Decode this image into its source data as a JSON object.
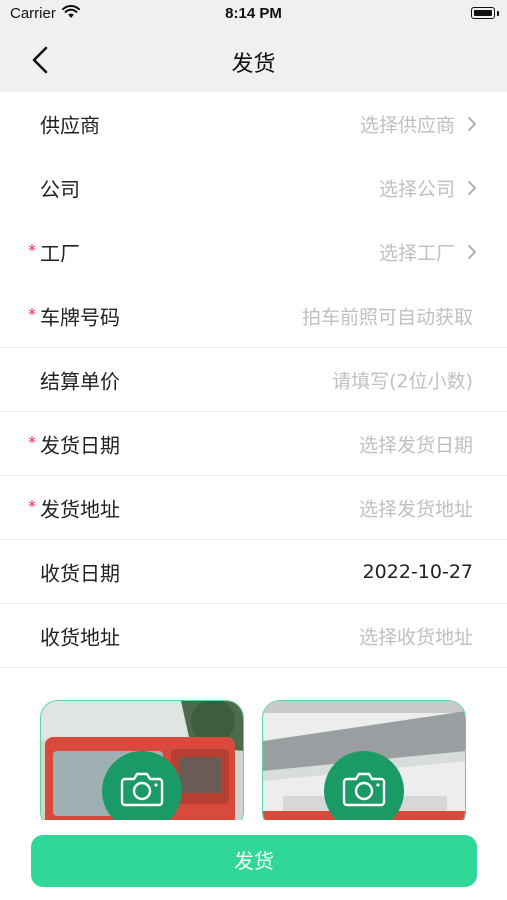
{
  "status_bar": {
    "carrier": "Carrier",
    "time": "8:14 PM"
  },
  "nav": {
    "title": "发货"
  },
  "form": {
    "rows": [
      {
        "label": "供应商",
        "required": false,
        "value": "选择供应商",
        "arrow": true,
        "filled": false
      },
      {
        "label": "公司",
        "required": false,
        "value": "选择公司",
        "arrow": true,
        "filled": false
      },
      {
        "label": "工厂",
        "required": true,
        "value": "选择工厂",
        "arrow": true,
        "filled": false
      },
      {
        "label": "车牌号码",
        "required": true,
        "value": "拍车前照可自动获取",
        "arrow": false,
        "filled": false
      },
      {
        "label": "结算单价",
        "required": false,
        "value": "请填写(2位小数)",
        "arrow": false,
        "filled": false
      },
      {
        "label": "发货日期",
        "required": true,
        "value": "选择发货日期",
        "arrow": false,
        "filled": false
      },
      {
        "label": "发货地址",
        "required": true,
        "value": "选择发货地址",
        "arrow": false,
        "filled": false
      },
      {
        "label": "收货日期",
        "required": false,
        "value": "2022-10-27",
        "arrow": false,
        "filled": true
      },
      {
        "label": "收货地址",
        "required": false,
        "value": "选择收货地址",
        "arrow": false,
        "filled": false
      }
    ]
  },
  "photos": [
    {
      "icon": "camera-icon"
    },
    {
      "icon": "camera-icon"
    }
  ],
  "submit": {
    "label": "发货"
  },
  "colors": {
    "accent": "#2fd898",
    "camera_bg": "#1a9a64",
    "required": "#e8283c",
    "placeholder": "#c0c0c0"
  }
}
